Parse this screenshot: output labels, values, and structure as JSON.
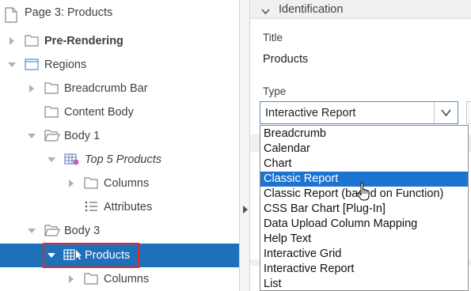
{
  "tree": {
    "nodes": [
      {
        "label": "Page 3: Products",
        "icon": "page-icon",
        "expander": "none",
        "style": "normal"
      },
      {
        "label": "Pre-Rendering",
        "icon": "folder-icon",
        "expander": "collapsed",
        "style": "bold"
      },
      {
        "label": "Regions",
        "icon": "regions-icon",
        "expander": "expanded",
        "style": "normal"
      },
      {
        "label": "Breadcrumb Bar",
        "icon": "folder-icon",
        "expander": "collapsed",
        "style": "normal"
      },
      {
        "label": "Content Body",
        "icon": "folder-icon",
        "expander": "none",
        "style": "normal"
      },
      {
        "label": "Body 1",
        "icon": "folder-open-icon",
        "expander": "expanded",
        "style": "normal"
      },
      {
        "label": "Top 5 Products",
        "icon": "report-icon",
        "expander": "expanded",
        "style": "italic"
      },
      {
        "label": "Columns",
        "icon": "folder-icon",
        "expander": "collapsed",
        "style": "normal"
      },
      {
        "label": "Attributes",
        "icon": "list-icon",
        "expander": "none",
        "style": "normal"
      },
      {
        "label": "Body 3",
        "icon": "folder-open-icon",
        "expander": "expanded",
        "style": "normal"
      },
      {
        "label": "Products",
        "icon": "grid-cursor-icon",
        "expander": "expanded",
        "style": "selected"
      },
      {
        "label": "Columns",
        "icon": "folder-icon",
        "expander": "collapsed",
        "style": "normal"
      }
    ]
  },
  "properties": {
    "section_title": "Identification",
    "title_label": "Title",
    "title_value": "Products",
    "type_label": "Type",
    "type_value": "Interactive Report",
    "dropdown_options": [
      "Breadcrumb",
      "Calendar",
      "Chart",
      "Classic Report",
      "Classic Report (based on Function)",
      "CSS Bar Chart [Plug-In]",
      "Data Upload Column Mapping",
      "Help Text",
      "Interactive Grid",
      "Interactive Report",
      "List"
    ],
    "highlighted_option": "Classic Report"
  },
  "colors": {
    "selection": "#1e70b8",
    "highlight": "#1e72d0",
    "annotation_box": "#e8262a"
  }
}
